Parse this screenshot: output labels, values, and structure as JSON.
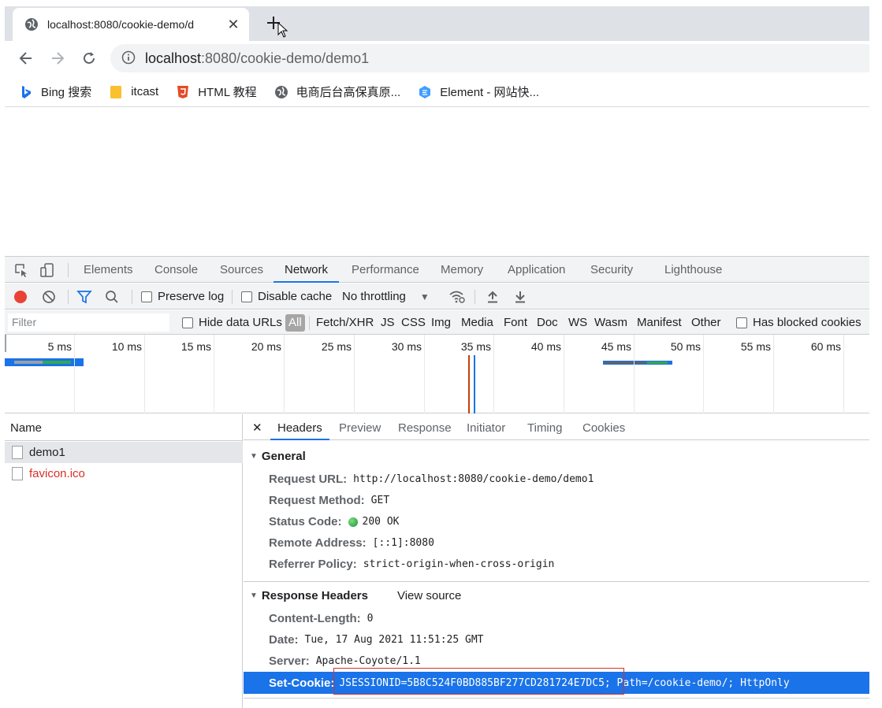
{
  "browser": {
    "tab_title": "localhost:8080/cookie-demo/d",
    "url_host": "localhost",
    "url_rest": ":8080/cookie-demo/demo1",
    "bookmarks": [
      {
        "label": "Bing 搜索",
        "icon": "bing-icon"
      },
      {
        "label": "itcast",
        "icon": "folder-icon"
      },
      {
        "label": "HTML 教程",
        "icon": "html5-icon"
      },
      {
        "label": "电商后台高保真原...",
        "icon": "globe-icon"
      },
      {
        "label": "Element - 网站快...",
        "icon": "element-icon"
      }
    ]
  },
  "devtools": {
    "tabs": [
      "Elements",
      "Console",
      "Sources",
      "Network",
      "Performance",
      "Memory",
      "Application",
      "Security",
      "Lighthouse"
    ],
    "active_tab": "Network",
    "network_toolbar": {
      "preserve_log": "Preserve log",
      "disable_cache": "Disable cache",
      "throttling": "No throttling"
    },
    "filter": {
      "placeholder": "Filter",
      "hide_data_urls": "Hide data URLs",
      "types": [
        "All",
        "Fetch/XHR",
        "JS",
        "CSS",
        "Img",
        "Media",
        "Font",
        "Doc",
        "WS",
        "Wasm",
        "Manifest",
        "Other"
      ],
      "has_blocked_cookies": "Has blocked cookies"
    },
    "timeline_ticks": [
      "5 ms",
      "10 ms",
      "15 ms",
      "20 ms",
      "25 ms",
      "30 ms",
      "35 ms",
      "40 ms",
      "45 ms",
      "50 ms",
      "55 ms",
      "60 ms"
    ],
    "requests": {
      "header": "Name",
      "items": [
        {
          "name": "demo1",
          "status": "ok"
        },
        {
          "name": "favicon.ico",
          "status": "error"
        }
      ]
    },
    "details": {
      "tabs": [
        "Headers",
        "Preview",
        "Response",
        "Initiator",
        "Timing",
        "Cookies"
      ],
      "active_tab": "Headers",
      "general": {
        "title": "General",
        "rows": [
          {
            "key": "Request URL:",
            "value": "http://localhost:8080/cookie-demo/demo1"
          },
          {
            "key": "Request Method:",
            "value": "GET"
          },
          {
            "key": "Status Code:",
            "value": "200 OK"
          },
          {
            "key": "Remote Address:",
            "value": "[::1]:8080"
          },
          {
            "key": "Referrer Policy:",
            "value": "strict-origin-when-cross-origin"
          }
        ]
      },
      "response_headers": {
        "title": "Response Headers",
        "view_source": "View source",
        "rows": [
          {
            "key": "Content-Length:",
            "value": "0"
          },
          {
            "key": "Date:",
            "value": "Tue, 17 Aug 2021 11:51:25 GMT"
          },
          {
            "key": "Server:",
            "value": "Apache-Coyote/1.1"
          }
        ],
        "set_cookie": {
          "key": "Set-Cookie:",
          "value": "JSESSIONID=5B8C524F0BD885BF277CD281724E7DC5; Path=/cookie-demo/; HttpOnly"
        }
      }
    }
  },
  "colors": {
    "accent": "#1a73e8",
    "record": "#ea4335",
    "error_text": "#d93025",
    "status_ok": "#34a853"
  }
}
